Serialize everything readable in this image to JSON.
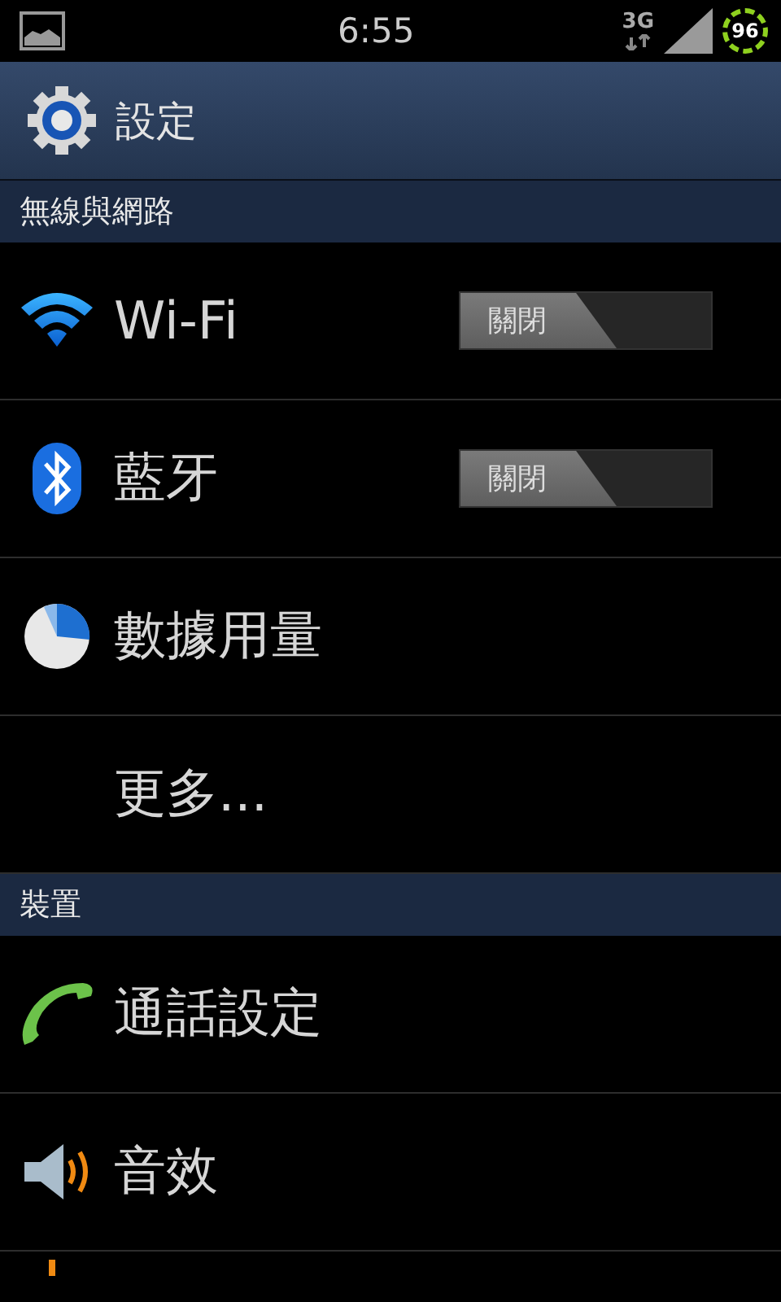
{
  "status_bar": {
    "time": "6:55",
    "network": "3G",
    "battery": "96"
  },
  "action_bar": {
    "title": "設定"
  },
  "sections": [
    {
      "title": "無線與網路",
      "items": [
        {
          "kind": "toggle",
          "label": "Wi-Fi",
          "switch_label": "關閉",
          "on": false
        },
        {
          "kind": "toggle",
          "label": "藍牙",
          "switch_label": "關閉",
          "on": false
        },
        {
          "kind": "plain",
          "label": "數據用量"
        },
        {
          "kind": "plain",
          "label": "更多..."
        }
      ]
    },
    {
      "title": "裝置",
      "items": [
        {
          "kind": "plain",
          "label": "通話設定"
        },
        {
          "kind": "plain",
          "label": "音效"
        }
      ]
    }
  ]
}
